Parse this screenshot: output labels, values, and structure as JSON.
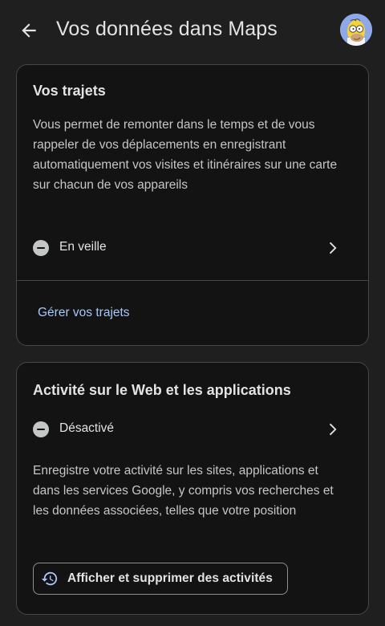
{
  "header": {
    "title": "Vos données dans Maps",
    "back_icon": "arrow-back-icon",
    "avatar_icon": "homer-avatar"
  },
  "cards": {
    "timeline": {
      "title": "Vos trajets",
      "description": "Vous permet de remonter dans le temps et de vous rappeler de vos déplacements en enregistrant automatiquement vos visites et itinéraires sur une carte sur chacun de vos appareils",
      "status": "En veille",
      "link": "Gérer vos trajets"
    },
    "web_activity": {
      "title": "Activité sur le Web et les applications",
      "status": "Désactivé",
      "description": "Enregistre votre activité sur les sites, applications et dans les services Google, y compris vos recherches et les données associées, telles que votre position",
      "button": "Afficher et supprimer des activités"
    }
  },
  "colors": {
    "background": "#1f1f1f",
    "card": "#131313",
    "border": "#444746",
    "link": "#a8c7fa",
    "text": "#e3e3e3",
    "secondary_text": "#c4c7c5"
  }
}
